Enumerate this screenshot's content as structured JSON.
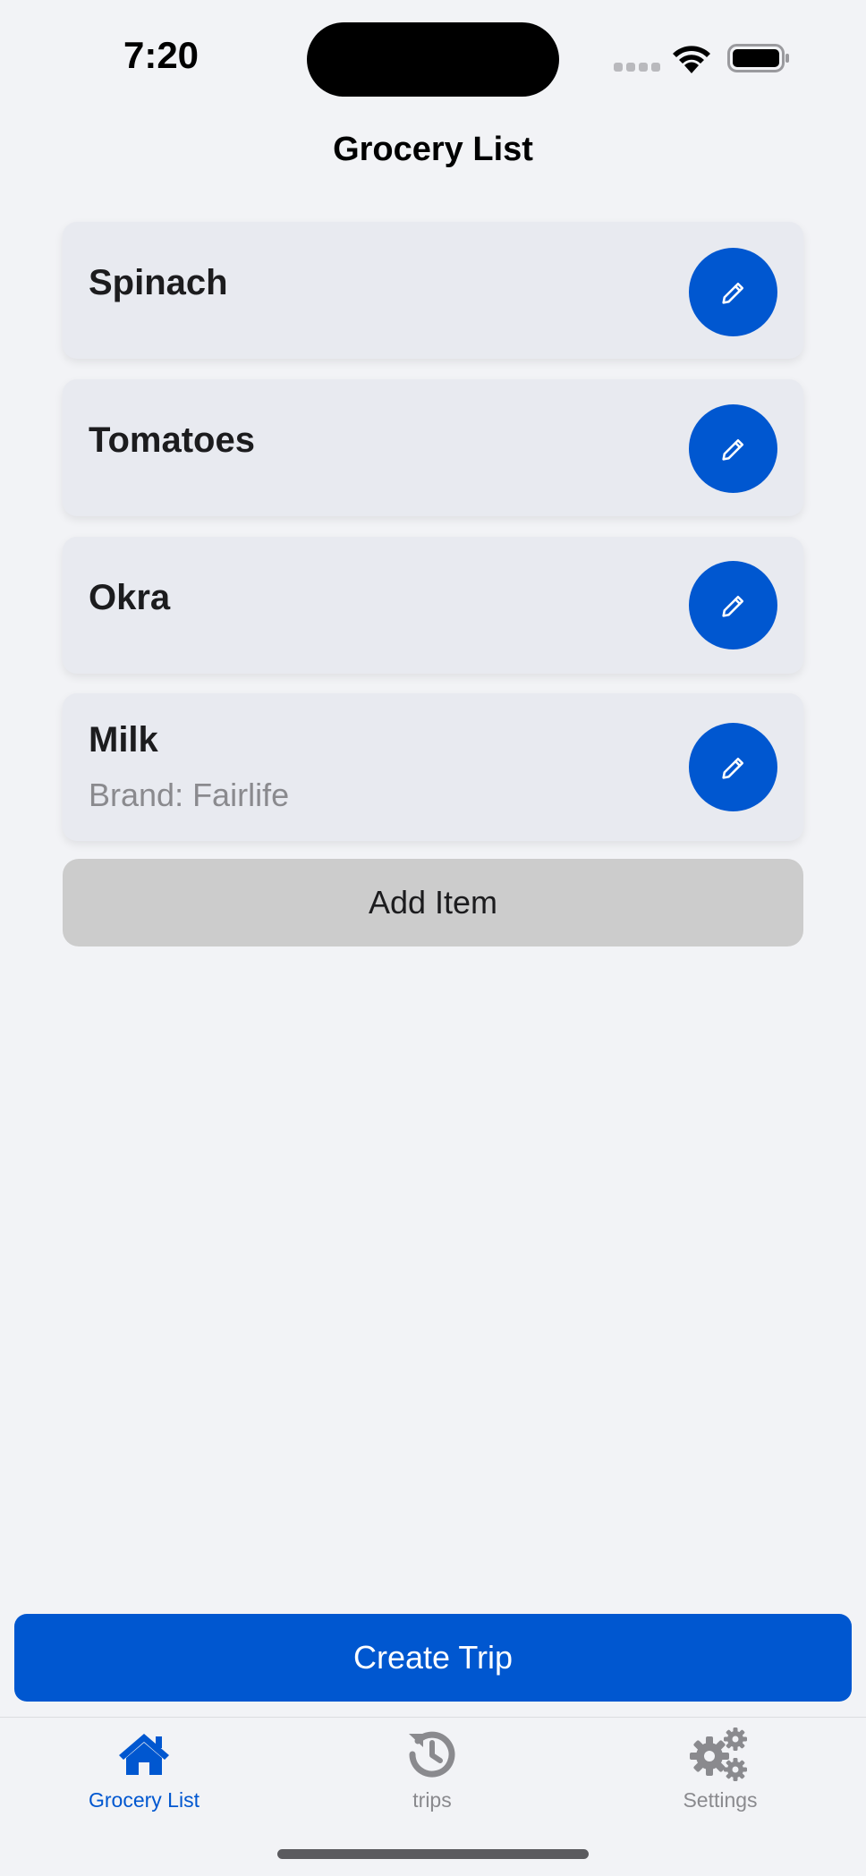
{
  "status_bar": {
    "time": "7:20"
  },
  "header": {
    "title": "Grocery List"
  },
  "items": [
    {
      "name": "Spinach",
      "brand": ""
    },
    {
      "name": "Tomatoes",
      "brand": ""
    },
    {
      "name": "Okra",
      "brand": ""
    },
    {
      "name": "Milk",
      "brand": "Brand: Fairlife"
    }
  ],
  "actions": {
    "add_item_label": "Add Item",
    "create_trip_label": "Create Trip"
  },
  "tab_bar": {
    "tabs": [
      {
        "label": "Grocery List",
        "icon": "home-icon",
        "active": true
      },
      {
        "label": "trips",
        "icon": "history-icon",
        "active": false
      },
      {
        "label": "Settings",
        "icon": "gears-icon",
        "active": false
      }
    ],
    "active_color": "#0057d0",
    "inactive_color": "#8a8a8e"
  },
  "colors": {
    "accent": "#0057d0",
    "background": "#f2f3f6",
    "card": "#e8eaf0",
    "secondary_button": "#cccccc"
  }
}
